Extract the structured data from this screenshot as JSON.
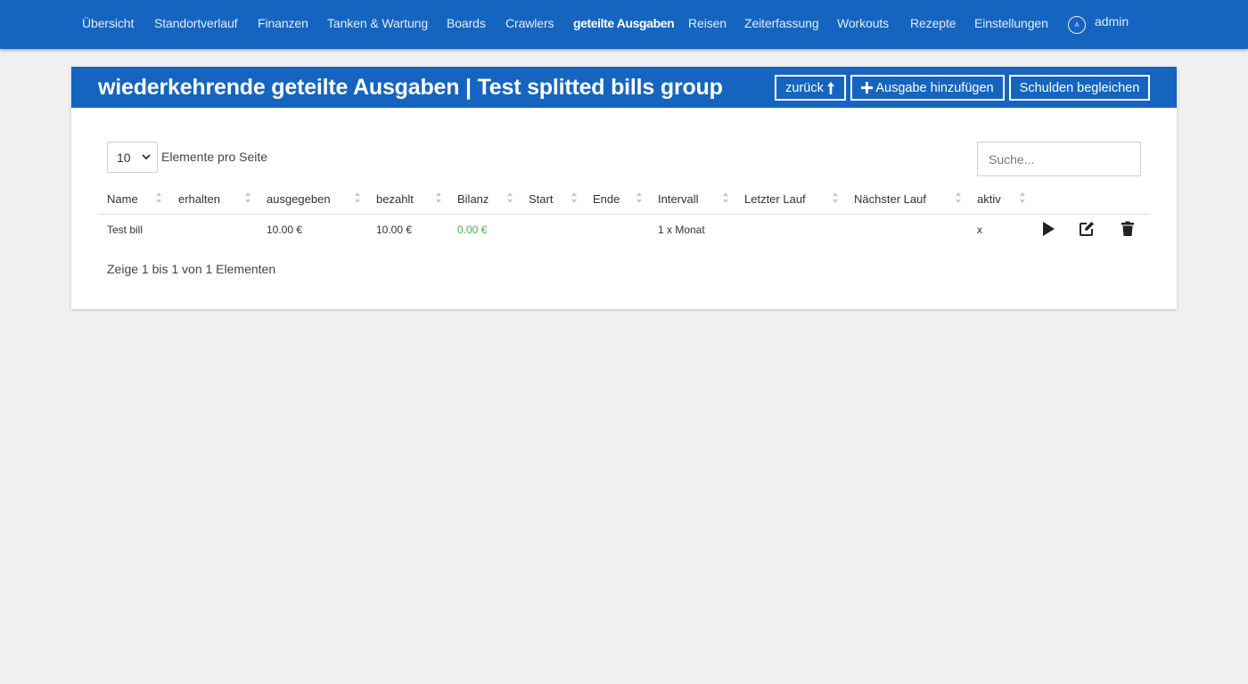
{
  "nav": {
    "items": [
      {
        "label": "Übersicht"
      },
      {
        "label": "Standortverlauf"
      },
      {
        "label": "Finanzen"
      },
      {
        "label": "Tanken & Wartung"
      },
      {
        "label": "Boards"
      },
      {
        "label": "Crawlers"
      },
      {
        "label": "geteilte Ausgaben",
        "active": true
      },
      {
        "label": "Reisen"
      },
      {
        "label": "Zeiterfassung"
      },
      {
        "label": "Workouts"
      },
      {
        "label": "Rezepte"
      },
      {
        "label": "Einstellungen"
      }
    ],
    "user": {
      "avatar_letter": "A",
      "label": "admin"
    }
  },
  "header": {
    "title": "wiederkehrende geteilte Ausgaben | Test splitted bills group",
    "back_label": "zurück",
    "add_label": "Ausgabe hinzufügen",
    "settle_label": "Schulden begleichen"
  },
  "controls": {
    "page_size": "10",
    "page_size_label": "Elemente pro Seite",
    "search_placeholder": "Suche..."
  },
  "table": {
    "columns": [
      "Name",
      "erhalten",
      "ausgegeben",
      "bezahlt",
      "Bilanz",
      "Start",
      "Ende",
      "Intervall",
      "Letzter Lauf",
      "Nächster Lauf",
      "aktiv"
    ],
    "rows": [
      {
        "name": "Test bill",
        "received": "",
        "spent": "10.00 €",
        "paid": "10.00 €",
        "balance": "0.00 €",
        "start": "",
        "end": "",
        "interval": "1 x Monat",
        "last_run": "",
        "next_run": "",
        "active": "x"
      }
    ]
  },
  "footer": {
    "info": "Zeige 1 bis 1 von 1 Elementen"
  },
  "colors": {
    "primary": "#1565c0",
    "positive": "#4caf50",
    "background": "#f0f0f0"
  }
}
